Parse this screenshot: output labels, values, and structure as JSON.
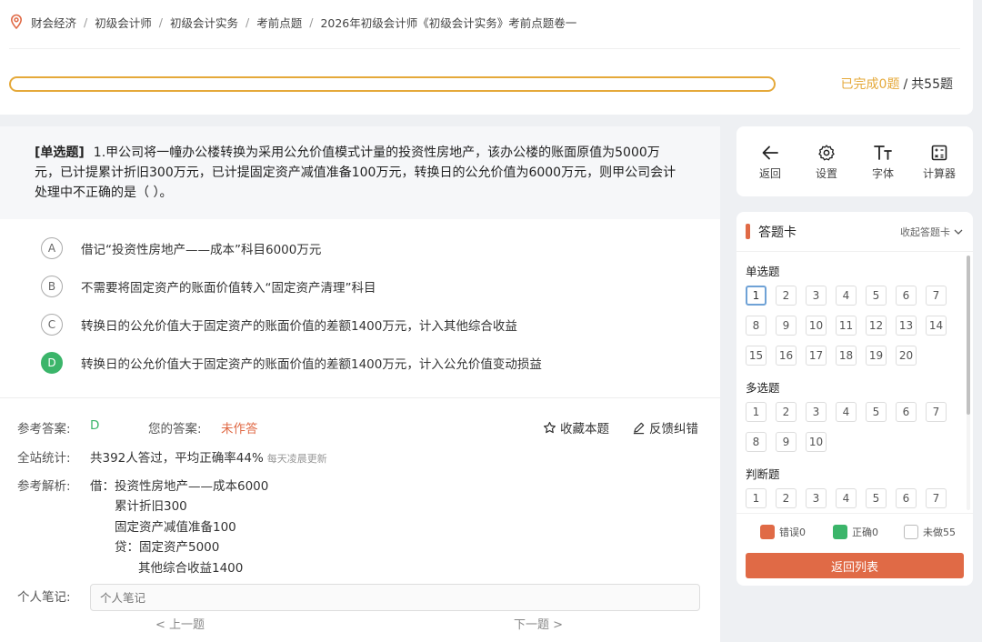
{
  "breadcrumb": [
    "财会经济",
    "初级会计师",
    "初级会计实务",
    "考前点题",
    "2026年初级会计师《初级会计实务》考前点题卷一"
  ],
  "progress": {
    "completed_text": "已完成0题",
    "sep": "/",
    "total_text": "共55题",
    "completed": 0,
    "total": 55,
    "fill_fraction": 0,
    "bar_color": "#e5a93a"
  },
  "question": {
    "type_label": "[单选题]",
    "text": "1.甲公司将一幢办公楼转换为采用公允价值模式计量的投资性房地产，该办公楼的账面原值为5000万元，已计提累计折旧300万元，已计提固定资产减值准备100万元，转换日的公允价值为6000万元，则甲公司会计处理中不正确的是（    ）。",
    "options": [
      {
        "letter": "A",
        "text": "借记“投资性房地产——成本”科目6000万元"
      },
      {
        "letter": "B",
        "text": "不需要将固定资产的账面价值转入“固定资产清理”科目"
      },
      {
        "letter": "C",
        "text": "转换日的公允价值大于固定资产的账面价值的差额1400万元，计入其他综合收益"
      },
      {
        "letter": "D",
        "text": "转换日的公允价值大于固定资产的账面价值的差额1400万元，计入公允价值变动损益"
      }
    ],
    "highlighted_option": "D"
  },
  "answer": {
    "ref_label": "参考答案:",
    "ref_value": "D",
    "yours_label": "您的答案:",
    "yours_value": "未作答",
    "favorite_label": "收藏本题",
    "feedback_label": "反馈纠错",
    "stats_label": "全站统计:",
    "stats_text": "共392人答过，平均正确率44%",
    "stats_note": "每天凌晨更新",
    "analysis_label": "参考解析:",
    "analysis_lines": [
      "借：投资性房地产——成本6000",
      "累计折旧300",
      "固定资产减值准备100",
      "贷：固定资产5000",
      "其他综合收益1400"
    ],
    "notes_label": "个人笔记:",
    "notes_placeholder": "个人笔记"
  },
  "nav": {
    "prev": "< 上一题",
    "next": "下一题 >"
  },
  "tools": [
    {
      "label": "返回",
      "icon": "arrow-left-icon"
    },
    {
      "label": "设置",
      "icon": "gear-icon"
    },
    {
      "label": "字体",
      "icon": "font-size-icon"
    },
    {
      "label": "计算器",
      "icon": "calculator-icon"
    }
  ],
  "card": {
    "title": "答题卡",
    "collapse_label": "收起答题卡",
    "sections": [
      {
        "title": "单选题",
        "numbers": [
          "1",
          "2",
          "3",
          "4",
          "5",
          "6",
          "7",
          "8",
          "9",
          "10",
          "11",
          "12",
          "13",
          "14",
          "15",
          "16",
          "17",
          "18",
          "19",
          "20"
        ]
      },
      {
        "title": "多选题",
        "numbers": [
          "1",
          "2",
          "3",
          "4",
          "5",
          "6",
          "7",
          "8",
          "9",
          "10"
        ]
      },
      {
        "title": "判断题",
        "numbers": [
          "1",
          "2",
          "3",
          "4",
          "5",
          "6",
          "7"
        ]
      }
    ],
    "current": "1",
    "legend": [
      {
        "label": "错误0",
        "color": "#e06a46"
      },
      {
        "label": "正确0",
        "color": "#3bb56a"
      },
      {
        "label": "未做55",
        "color": "#ffffff"
      }
    ],
    "back_button": "返回列表"
  },
  "colors": {
    "accent": "#e06a46",
    "correct": "#3bb56a",
    "progress": "#e5a93a",
    "current_cell": "#6fa2d6"
  }
}
